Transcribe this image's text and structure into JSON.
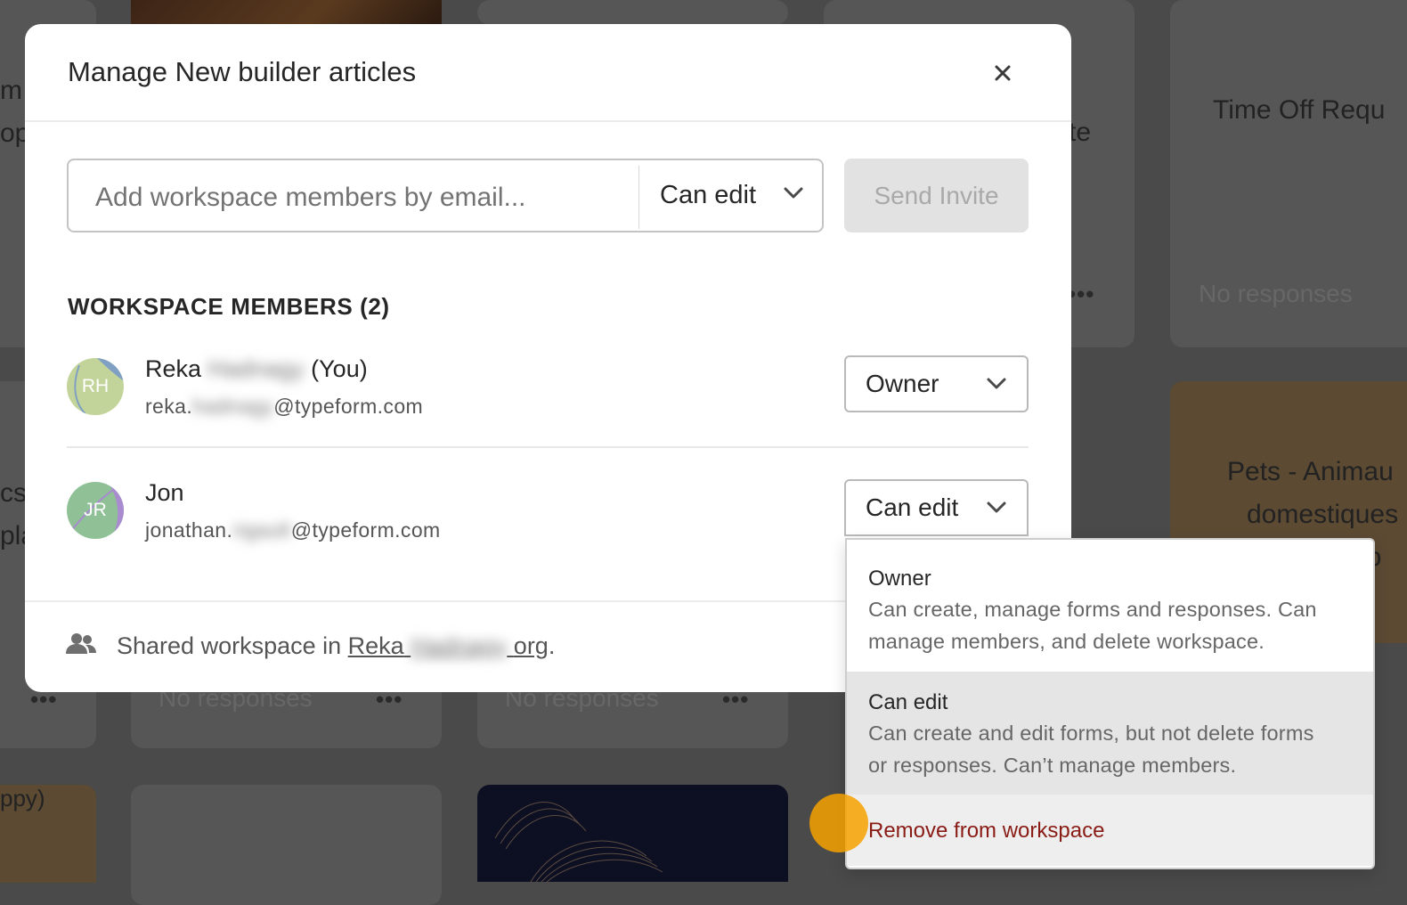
{
  "background": {
    "card_title_right": "Time Off Requ",
    "card_title_mid": "te",
    "card_title_left_1": "m",
    "card_title_left_2": "op",
    "card_left_mid_1": "cs",
    "card_left_mid_2": "pla",
    "pets_title": [
      "Pets - Animau",
      "domestiques",
      "op"
    ],
    "no_responses": "No responses",
    "left_partial": "ppy)",
    "more_dots": "•••"
  },
  "modal": {
    "title": "Manage New builder articles",
    "invite": {
      "placeholder": "Add workspace members by email...",
      "role": "Can edit",
      "send_label": "Send Invite"
    },
    "section_title": "WORKSPACE MEMBERS (2)",
    "members": [
      {
        "initials": "RH",
        "first_name": "Reka",
        "last_name_hidden": "Hadnagy",
        "you_label": "(You)",
        "email_prefix": "reka.",
        "email_hidden": "hadnagy",
        "email_domain": "@typeform.com",
        "role": "Owner"
      },
      {
        "initials": "JR",
        "first_name": "Jon",
        "email_prefix": "jonathan.",
        "email_hidden": "rigault",
        "email_domain": "@typeform.com",
        "role": "Can edit"
      }
    ],
    "footer": {
      "prefix": "Shared workspace in ",
      "link_first": "Reka",
      "link_hidden": "Hadnagy",
      "link_suffix": "org",
      "end": "."
    }
  },
  "dropdown": {
    "options": [
      {
        "title": "Owner",
        "desc_line1": "Can create, manage forms and responses. Can",
        "desc_line2": "manage members, and delete workspace."
      },
      {
        "title": "Can edit",
        "desc_line1": "Can create and edit forms, but not delete forms",
        "desc_line2": "or responses. Can’t manage members."
      }
    ],
    "remove_label": "Remove from workspace"
  },
  "colors": {
    "overlay": "#4a4a4a",
    "remove_text": "#8a1c16",
    "cursor": "#f6a100",
    "selected_option_bg": "#e5e5e5"
  }
}
